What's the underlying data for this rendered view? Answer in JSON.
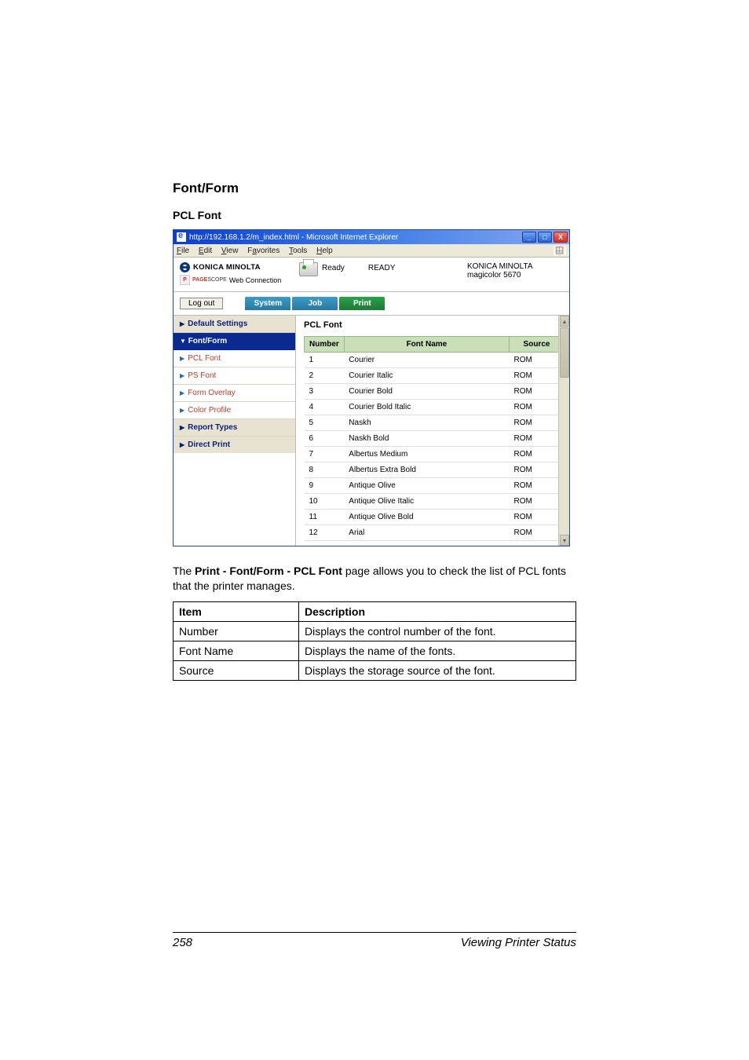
{
  "headings": {
    "h1": "Font/Form",
    "h2": "PCL Font"
  },
  "ie": {
    "title": "http://192.168.1.2/m_index.html - Microsoft Internet Explorer",
    "menus": {
      "file": "File",
      "edit": "Edit",
      "view": "View",
      "favorites": "Favorites",
      "tools": "Tools",
      "help": "Help"
    }
  },
  "header": {
    "brand": "KONICA MINOLTA",
    "pagescope_brand": "PAGE",
    "pagescope": "Web Connection",
    "ready_small": "Ready",
    "ready_big": "READY",
    "device_brand": "KONICA MINOLTA",
    "device_model": "magicolor 5670"
  },
  "nav": {
    "logout": "Log out",
    "tabs": [
      "System",
      "Job",
      "Print"
    ]
  },
  "sidebar": {
    "default": "Default Settings",
    "fontform": "Font/Form",
    "items": [
      "PCL Font",
      "PS Font",
      "Form Overlay",
      "Color Profile"
    ],
    "report": "Report Types",
    "direct": "Direct Print"
  },
  "table": {
    "title": "PCL Font",
    "headers": {
      "number": "Number",
      "name": "Font Name",
      "source": "Source"
    },
    "rows": [
      {
        "n": "1",
        "name": "Courier",
        "src": "ROM"
      },
      {
        "n": "2",
        "name": "Courier Italic",
        "src": "ROM"
      },
      {
        "n": "3",
        "name": "Courier Bold",
        "src": "ROM"
      },
      {
        "n": "4",
        "name": "Courier Bold Italic",
        "src": "ROM"
      },
      {
        "n": "5",
        "name": "Naskh",
        "src": "ROM"
      },
      {
        "n": "6",
        "name": "Naskh Bold",
        "src": "ROM"
      },
      {
        "n": "7",
        "name": "Albertus Medium",
        "src": "ROM"
      },
      {
        "n": "8",
        "name": "Albertus Extra Bold",
        "src": "ROM"
      },
      {
        "n": "9",
        "name": "Antique Olive",
        "src": "ROM"
      },
      {
        "n": "10",
        "name": "Antique Olive Italic",
        "src": "ROM"
      },
      {
        "n": "11",
        "name": "Antique Olive Bold",
        "src": "ROM"
      },
      {
        "n": "12",
        "name": "Arial",
        "src": "ROM"
      }
    ]
  },
  "caption": {
    "pre": "The ",
    "bold": "Print - Font/Form - PCL Font",
    "post": " page allows you to check the list of PCL fonts that the printer manages."
  },
  "desc_table": {
    "header": {
      "item": "Item",
      "desc": "Description"
    },
    "rows": [
      {
        "item": "Number",
        "desc": "Displays the control number of the font."
      },
      {
        "item": "Font Name",
        "desc": "Displays the name of the fonts."
      },
      {
        "item": "Source",
        "desc": "Displays the storage source of the font."
      }
    ]
  },
  "footer": {
    "page": "258",
    "label": "Viewing Printer Status"
  }
}
